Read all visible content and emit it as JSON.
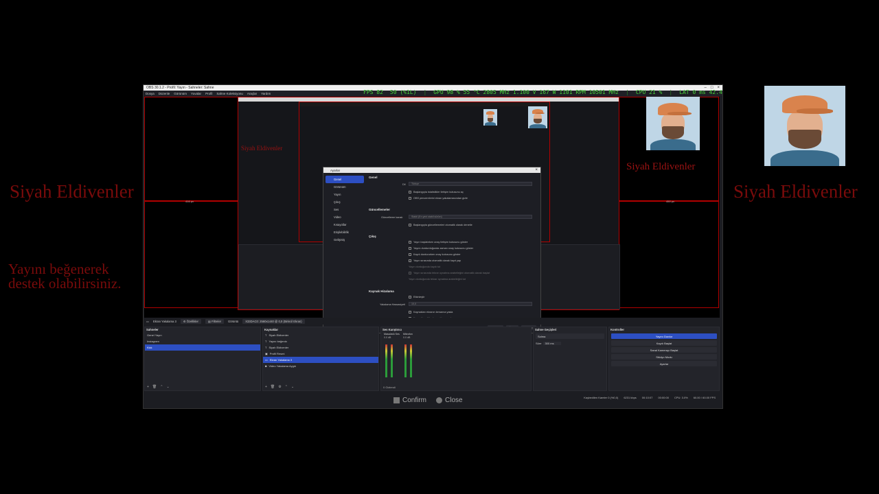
{
  "overlay": {
    "left_title": "Siyah Eldivenler",
    "left_subtitle": "Yayını beğenerek\ndestek olabilirsiniz.",
    "right_title": "Siyah Eldivenler"
  },
  "obs": {
    "title": "OBS 30.1.2 - Profil: Yayın - Sahneler: Sahne",
    "menu": [
      "Dosya",
      "Düzenle",
      "Görünüm",
      "Yuvalar",
      "Profil",
      "Sahne Koleksiyonu",
      "Araçlar",
      "Yardım"
    ],
    "stats": {
      "fps": "FPS 82",
      "low": "50 (%1L)",
      "gpu": "GPU 98 % 55 °C 2805 MHz 1.100 V 167 W 1101 RPM 10501 MHz",
      "cpu": "CPU 21 %",
      "lat": "LAT 0 ms 42.4 ms"
    },
    "preview": {
      "title_overlay": "Siyah Eldivenler",
      "res_left": "416 px",
      "res_right": "450 px"
    },
    "settings": {
      "title": "Ayarlar",
      "nav": [
        "Genel",
        "Görünüm",
        "Yayın",
        "Çıkış",
        "Ses",
        "Video",
        "Kısayollar",
        "Erişilebilirlik",
        "Gelişmiş"
      ],
      "sections": {
        "general": "Genel",
        "updates": "Güncellemeler",
        "output": "Çıkış",
        "source_align": "Kaynak Hizalama"
      },
      "language_label": "Dil",
      "language_value": "Türkçe",
      "general_checks": [
        "Başlangıçta istatistikler iletişim kutusunu aç",
        "OBS pencerelerini ekran yakalamasından gizle"
      ],
      "update_channel_label": "Güncelleme kanalı",
      "update_channel_value": "Stabil (En yeni stabil sürüm)",
      "update_check": "Başlangıçta güncellemeleri otomatik olarak denetle",
      "output_checks": [
        "Yayın başlatırken onay iletişim kutusunu göster",
        "Yayını durdurduğunda zaman onay kutusunu göster",
        "Kaydı durdururken onay kutusunu göster",
        "Yayın sırasında otomatik olarak kayıt yap",
        "Yayın durduğunda kaydı tut",
        "Yayın sırasında tekrar oynatma arabelleğini otomatik olarak başlat",
        "Yayın durduğunda tekrar oynatma arabelleğini tut"
      ],
      "snap_check": "Etkinleştir",
      "snap_label": "Yakalama Hassasiyeti",
      "snap_value": "10,0",
      "snap_checks": [
        "Kaynakları ekranın kenarına yasla",
        "Kaynakları diğer kaynaklara yasla"
      ],
      "buttons": {
        "ok": "Tamam",
        "cancel": "İptal",
        "apply": "Uygula"
      }
    },
    "source_bar": {
      "source": "Ekran Yakalama 3",
      "props": "Özellikler",
      "filters": "Filtreler",
      "display_label": "Görüntü",
      "display_value": "X33DAC0: 2560x1440 @ 0,0 (Birincil Ekran)"
    },
    "docks": {
      "scenes": {
        "title": "Sahneler",
        "items": [
          "Genel Yayın",
          "Instagram",
          "Kick"
        ],
        "selected": 2
      },
      "sources": {
        "title": "Kaynaklar",
        "items": [
          "Siyah Eldivenler",
          "Yayını beğenin",
          "Siyah Eldivenler",
          "Profil Resmi",
          "Ekran Yakalama 3",
          "Video Yakalama Aygıtı"
        ],
        "selected": 4
      },
      "mixer": {
        "title": "Ses Karıştırıcı",
        "ch1_name": "Masaüstü Ses",
        "ch1_db": "0.0 dB",
        "ch2_name": "Mikrofon",
        "ch2_db": "0.0 dB",
        "footer": "0 Gizlendi"
      },
      "transitions": {
        "title": "Sahne Geçişleri",
        "type": "Solma",
        "duration_label": "Süre",
        "duration_value": "300 ms"
      },
      "controls": {
        "title": "Kontroller",
        "buttons": [
          "Yayını Durdur",
          "Kaydı Başlat",
          "Sanal Kamerayı Başlat",
          "Stüdyo Modu",
          "Ayarlar"
        ],
        "active": 0
      }
    },
    "status": {
      "dropped": "Kaybedilen Kareler 0 (%0,0)",
      "bitrate": "6231 kbps",
      "stream_time": "00:10:07",
      "rec_time": "00:00:00",
      "cpu": "CPU: 3.0%",
      "fps": "60.00 / 60.00 FPS"
    }
  },
  "confirm_bar": {
    "confirm": "Confirm",
    "close": "Close"
  },
  "colors": {
    "accent": "#2d4fc2",
    "red_text": "#7a0b0b",
    "stats_green": "#48d13a",
    "source_border": "#b30000"
  }
}
